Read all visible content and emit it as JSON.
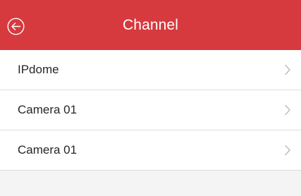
{
  "header": {
    "title": "Channel",
    "background": "#d63a3e",
    "back_icon": "circle-arrow-left-icon"
  },
  "channels": [
    {
      "label": "IPdome",
      "icon": "chevron-right-icon"
    },
    {
      "label": "Camera 01",
      "icon": "chevron-right-icon"
    },
    {
      "label": "Camera 01",
      "icon": "chevron-right-icon"
    }
  ]
}
